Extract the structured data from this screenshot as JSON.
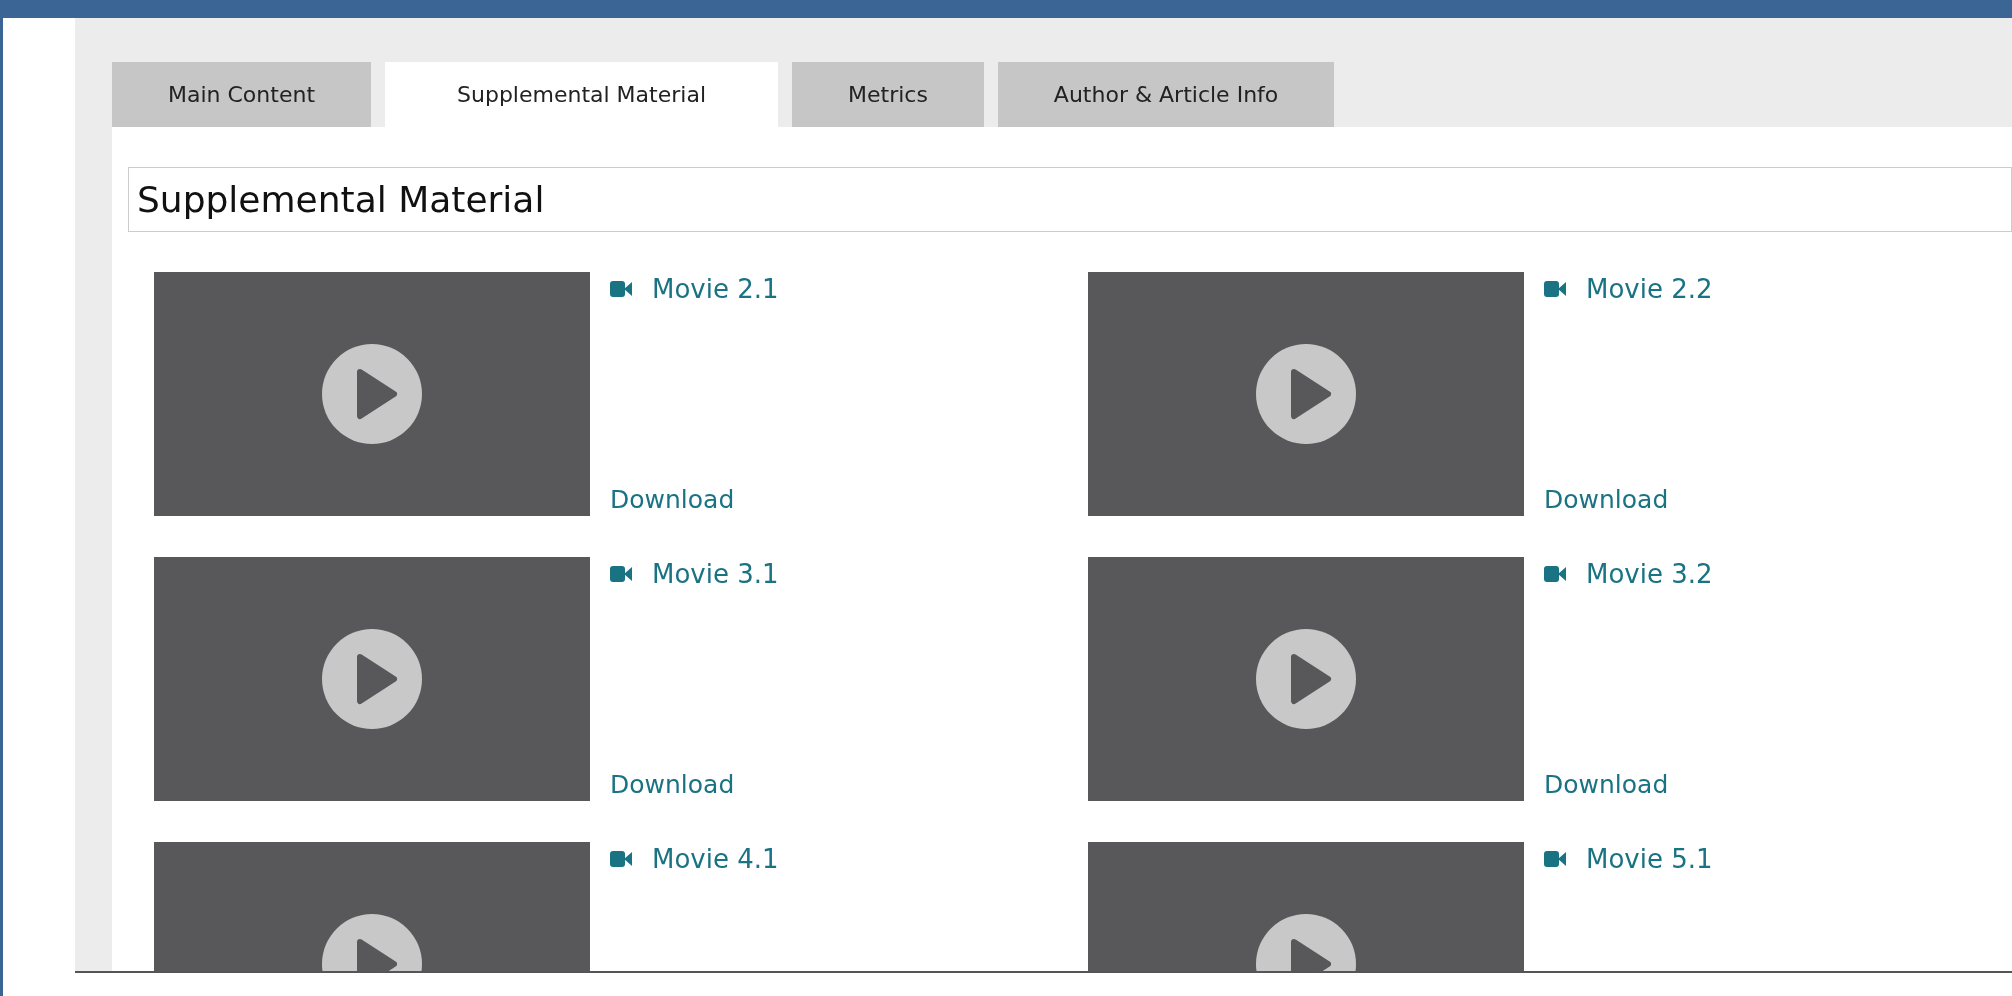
{
  "tabs": [
    {
      "label": "Main Content",
      "selected": false
    },
    {
      "label": "Supplemental Material",
      "selected": true
    },
    {
      "label": "Metrics",
      "selected": false
    },
    {
      "label": "Author & Article Info",
      "selected": false
    }
  ],
  "heading": "Supplemental Material",
  "movies": [
    {
      "title": "Movie 2.1",
      "download": "Download"
    },
    {
      "title": "Movie 2.2",
      "download": "Download"
    },
    {
      "title": "Movie 3.1",
      "download": "Download"
    },
    {
      "title": "Movie 3.2",
      "download": "Download"
    },
    {
      "title": "Movie 4.1"
    },
    {
      "title": "Movie 5.1"
    }
  ]
}
